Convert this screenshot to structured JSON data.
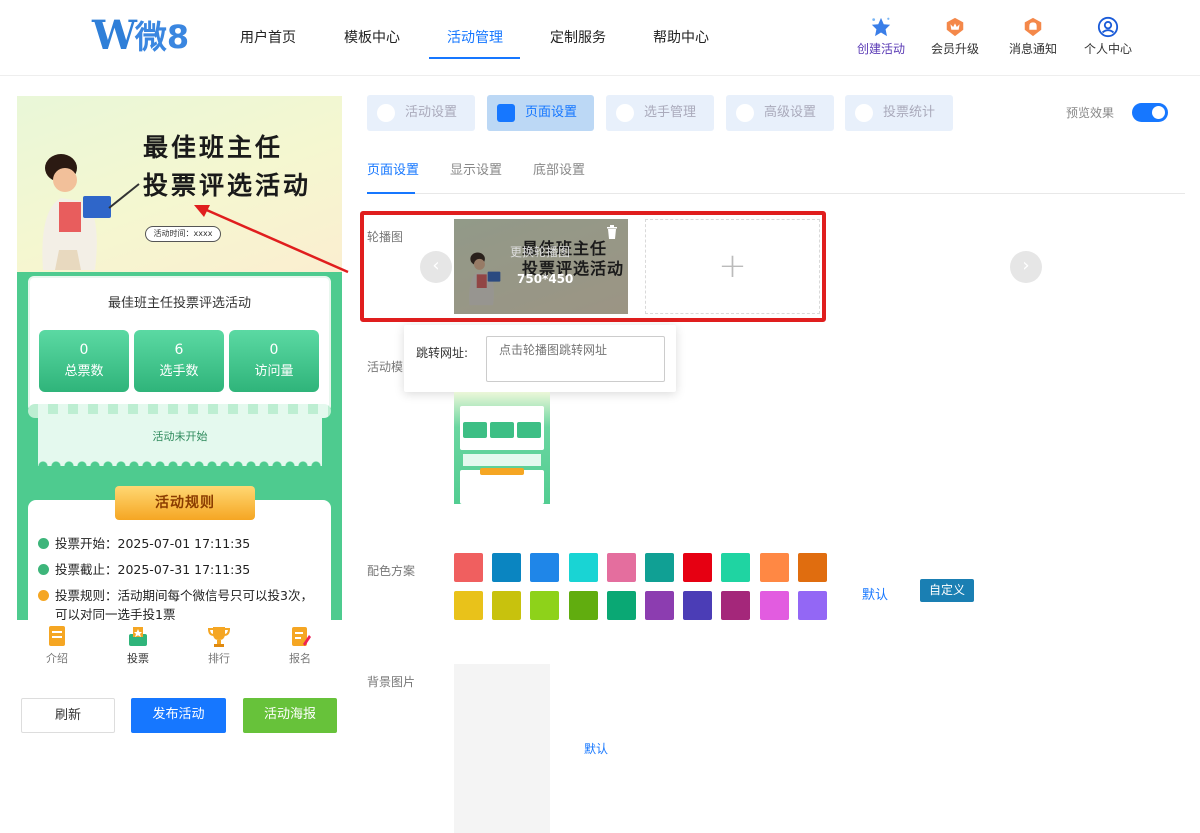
{
  "nav": {
    "logo_latin": "W",
    "logo_cn": "微8",
    "items": [
      "用户首页",
      "模板中心",
      "活动管理",
      "定制服务",
      "帮助中心"
    ],
    "active_index": 2,
    "right": [
      {
        "label": "创建活动",
        "icon": "star-icon"
      },
      {
        "label": "会员升级",
        "icon": "crown-badge-icon"
      },
      {
        "label": "消息通知",
        "icon": "bell-badge-icon"
      },
      {
        "label": "个人中心",
        "icon": "user-icon"
      }
    ]
  },
  "preview": {
    "banner_title_1": "最佳班主任",
    "banner_title_2": "投票评选活动",
    "banner_time": "活动时间：xxxx",
    "card_title": "最佳班主任投票评选活动",
    "stats": [
      {
        "value": "0",
        "label": "总票数"
      },
      {
        "value": "6",
        "label": "选手数"
      },
      {
        "value": "0",
        "label": "访问量"
      }
    ],
    "status": "活动未开始",
    "rules_title": "活动规则",
    "rules": [
      "投票开始：2025-07-01 17:11:35",
      "投票截止：2025-07-31 17:11:35",
      "投票规则：活动期间每个微信号只可以投3次，可以对同一选手投1票"
    ],
    "tabbar": [
      "介绍",
      "投票",
      "排行",
      "报名"
    ]
  },
  "actions": {
    "refresh": "刷新",
    "publish": "发布活动",
    "poster": "活动海报"
  },
  "main_tabs": [
    "活动设置",
    "页面设置",
    "选手管理",
    "高级设置",
    "投票统计"
  ],
  "main_tab_active": 1,
  "preview_toggle_label": "预览效果",
  "preview_toggle_on": true,
  "sub_tabs": [
    "页面设置",
    "显示设置",
    "底部设置"
  ],
  "sub_tab_active": 0,
  "fields": {
    "carousel_label": "轮播图",
    "replace_label": "更换轮播图",
    "slide_size": "750*450",
    "slide_title_1": "最佳班主任",
    "slide_title_2": "投票评选活动",
    "add_slide": "+",
    "jump_url_label": "跳转网址:",
    "jump_url_placeholder": "点击轮播图跳转网址",
    "template_label": "活动模",
    "color_label": "配色方案",
    "color_default": "默认",
    "color_custom": "自定义",
    "bg_label": "背景图片",
    "bg_default": "默认"
  },
  "colors": [
    "#f05f5f",
    "#0a85c1",
    "#1f86e8",
    "#19d4d4",
    "#e46e9e",
    "#10a094",
    "#e60012",
    "#1fd4a2",
    "#ff8844",
    "#e06d0f",
    "#e9c21a",
    "#c8c20d",
    "#8ed21a",
    "#61ad0f",
    "#0aa874",
    "#8c3db0",
    "#4b3db6",
    "#a4277a",
    "#e25ce0",
    "#9367f5"
  ],
  "theme": {
    "accent": "#1677ff",
    "highlight_border": "#e01e1e",
    "preview_green": "#4ecb8f"
  }
}
